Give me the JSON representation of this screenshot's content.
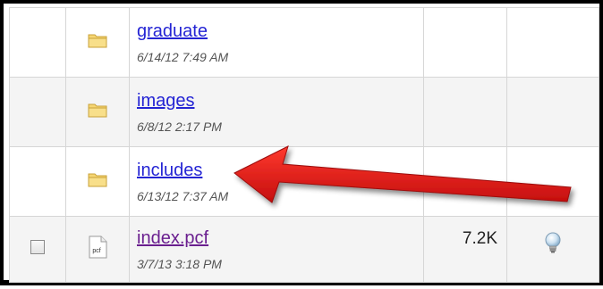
{
  "listing": {
    "rows": [
      {
        "name": "graduate",
        "date": "6/14/12 7:49 AM",
        "type": "folder",
        "icon": "folder-icon"
      },
      {
        "name": "images",
        "date": "6/8/12 2:17 PM",
        "type": "folder",
        "icon": "folder-icon"
      },
      {
        "name": "includes",
        "date": "6/13/12 7:37 AM",
        "type": "folder",
        "icon": "folder-icon"
      },
      {
        "name": "index.pcf",
        "date": "3/7/13 3:18 PM",
        "type": "file",
        "icon": "pcf-file-icon",
        "icon_label": "pcf",
        "size": "7.2K",
        "action_icon": "lightbulb-icon"
      }
    ]
  },
  "colors": {
    "link": "#2424d4",
    "visited_link": "#6a1f8f",
    "annotation_arrow": "#e01414",
    "folder": "#f2c94c"
  }
}
